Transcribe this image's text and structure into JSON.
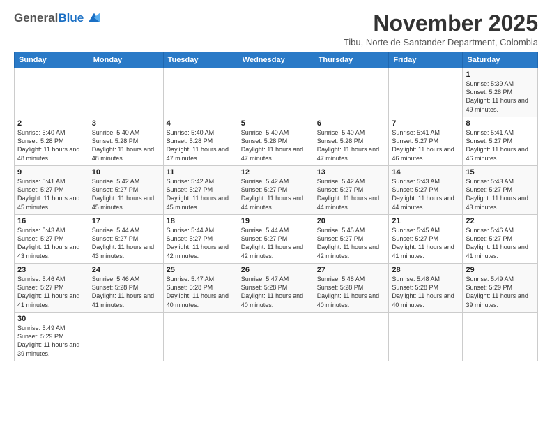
{
  "header": {
    "logo_general": "General",
    "logo_blue": "Blue",
    "month_title": "November 2025",
    "location": "Tibu, Norte de Santander Department, Colombia"
  },
  "weekdays": [
    "Sunday",
    "Monday",
    "Tuesday",
    "Wednesday",
    "Thursday",
    "Friday",
    "Saturday"
  ],
  "weeks": [
    [
      {
        "day": "",
        "info": ""
      },
      {
        "day": "",
        "info": ""
      },
      {
        "day": "",
        "info": ""
      },
      {
        "day": "",
        "info": ""
      },
      {
        "day": "",
        "info": ""
      },
      {
        "day": "",
        "info": ""
      },
      {
        "day": "1",
        "info": "Sunrise: 5:39 AM\nSunset: 5:28 PM\nDaylight: 11 hours and 49 minutes."
      }
    ],
    [
      {
        "day": "2",
        "info": "Sunrise: 5:40 AM\nSunset: 5:28 PM\nDaylight: 11 hours and 48 minutes."
      },
      {
        "day": "3",
        "info": "Sunrise: 5:40 AM\nSunset: 5:28 PM\nDaylight: 11 hours and 48 minutes."
      },
      {
        "day": "4",
        "info": "Sunrise: 5:40 AM\nSunset: 5:28 PM\nDaylight: 11 hours and 47 minutes."
      },
      {
        "day": "5",
        "info": "Sunrise: 5:40 AM\nSunset: 5:28 PM\nDaylight: 11 hours and 47 minutes."
      },
      {
        "day": "6",
        "info": "Sunrise: 5:40 AM\nSunset: 5:28 PM\nDaylight: 11 hours and 47 minutes."
      },
      {
        "day": "7",
        "info": "Sunrise: 5:41 AM\nSunset: 5:27 PM\nDaylight: 11 hours and 46 minutes."
      },
      {
        "day": "8",
        "info": "Sunrise: 5:41 AM\nSunset: 5:27 PM\nDaylight: 11 hours and 46 minutes."
      }
    ],
    [
      {
        "day": "9",
        "info": "Sunrise: 5:41 AM\nSunset: 5:27 PM\nDaylight: 11 hours and 45 minutes."
      },
      {
        "day": "10",
        "info": "Sunrise: 5:42 AM\nSunset: 5:27 PM\nDaylight: 11 hours and 45 minutes."
      },
      {
        "day": "11",
        "info": "Sunrise: 5:42 AM\nSunset: 5:27 PM\nDaylight: 11 hours and 45 minutes."
      },
      {
        "day": "12",
        "info": "Sunrise: 5:42 AM\nSunset: 5:27 PM\nDaylight: 11 hours and 44 minutes."
      },
      {
        "day": "13",
        "info": "Sunrise: 5:42 AM\nSunset: 5:27 PM\nDaylight: 11 hours and 44 minutes."
      },
      {
        "day": "14",
        "info": "Sunrise: 5:43 AM\nSunset: 5:27 PM\nDaylight: 11 hours and 44 minutes."
      },
      {
        "day": "15",
        "info": "Sunrise: 5:43 AM\nSunset: 5:27 PM\nDaylight: 11 hours and 43 minutes."
      }
    ],
    [
      {
        "day": "16",
        "info": "Sunrise: 5:43 AM\nSunset: 5:27 PM\nDaylight: 11 hours and 43 minutes."
      },
      {
        "day": "17",
        "info": "Sunrise: 5:44 AM\nSunset: 5:27 PM\nDaylight: 11 hours and 43 minutes."
      },
      {
        "day": "18",
        "info": "Sunrise: 5:44 AM\nSunset: 5:27 PM\nDaylight: 11 hours and 42 minutes."
      },
      {
        "day": "19",
        "info": "Sunrise: 5:44 AM\nSunset: 5:27 PM\nDaylight: 11 hours and 42 minutes."
      },
      {
        "day": "20",
        "info": "Sunrise: 5:45 AM\nSunset: 5:27 PM\nDaylight: 11 hours and 42 minutes."
      },
      {
        "day": "21",
        "info": "Sunrise: 5:45 AM\nSunset: 5:27 PM\nDaylight: 11 hours and 41 minutes."
      },
      {
        "day": "22",
        "info": "Sunrise: 5:46 AM\nSunset: 5:27 PM\nDaylight: 11 hours and 41 minutes."
      }
    ],
    [
      {
        "day": "23",
        "info": "Sunrise: 5:46 AM\nSunset: 5:27 PM\nDaylight: 11 hours and 41 minutes."
      },
      {
        "day": "24",
        "info": "Sunrise: 5:46 AM\nSunset: 5:28 PM\nDaylight: 11 hours and 41 minutes."
      },
      {
        "day": "25",
        "info": "Sunrise: 5:47 AM\nSunset: 5:28 PM\nDaylight: 11 hours and 40 minutes."
      },
      {
        "day": "26",
        "info": "Sunrise: 5:47 AM\nSunset: 5:28 PM\nDaylight: 11 hours and 40 minutes."
      },
      {
        "day": "27",
        "info": "Sunrise: 5:48 AM\nSunset: 5:28 PM\nDaylight: 11 hours and 40 minutes."
      },
      {
        "day": "28",
        "info": "Sunrise: 5:48 AM\nSunset: 5:28 PM\nDaylight: 11 hours and 40 minutes."
      },
      {
        "day": "29",
        "info": "Sunrise: 5:49 AM\nSunset: 5:29 PM\nDaylight: 11 hours and 39 minutes."
      }
    ],
    [
      {
        "day": "30",
        "info": "Sunrise: 5:49 AM\nSunset: 5:29 PM\nDaylight: 11 hours and 39 minutes."
      },
      {
        "day": "",
        "info": ""
      },
      {
        "day": "",
        "info": ""
      },
      {
        "day": "",
        "info": ""
      },
      {
        "day": "",
        "info": ""
      },
      {
        "day": "",
        "info": ""
      },
      {
        "day": "",
        "info": ""
      }
    ]
  ]
}
